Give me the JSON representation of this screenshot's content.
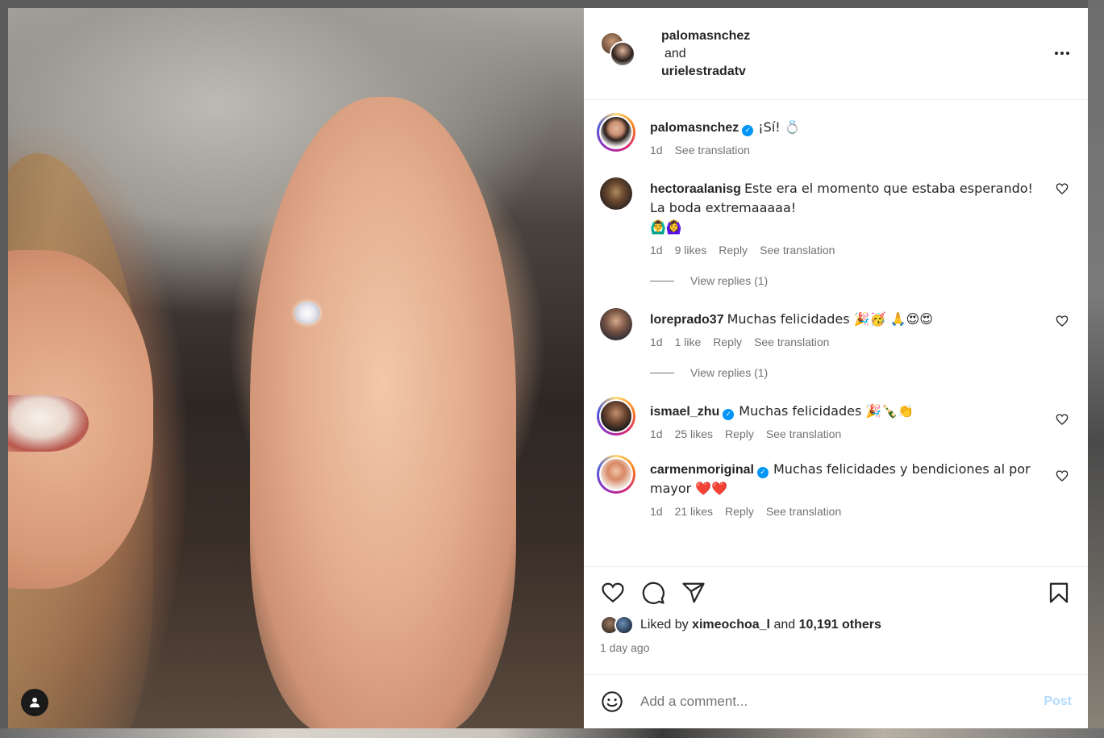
{
  "header": {
    "user1": "palomasnchez",
    "conjunction": "and",
    "user2": "urielestradatv"
  },
  "caption": {
    "user": "palomasnchez",
    "text": "¡Sí! 💍",
    "time": "1d",
    "see_translation": "See translation"
  },
  "comments": [
    {
      "user": "hectoraalanisg",
      "text": "Este era el momento que estaba esperando! La boda extremaaaaa!",
      "emoji": "🙆‍♂️🙆‍♀️",
      "time": "1d",
      "likes": "9 likes",
      "reply": "Reply",
      "see_translation": "See translation",
      "view_replies": "View replies (1)"
    },
    {
      "user": "loreprado37",
      "text": "Muchas felicidades 🎉🥳 🙏😍😍",
      "time": "1d",
      "likes": "1 like",
      "reply": "Reply",
      "see_translation": "See translation",
      "view_replies": "View replies (1)"
    },
    {
      "user": "ismael_zhu",
      "text": "Muchas felicidades 🎉🍾👏",
      "time": "1d",
      "likes": "25 likes",
      "reply": "Reply",
      "see_translation": "See translation"
    },
    {
      "user": "carmenmoriginal",
      "text": "Muchas felicidades y bendiciones al por mayor ❤️❤️",
      "time": "1d",
      "likes": "21 likes",
      "reply": "Reply",
      "see_translation": "See translation"
    }
  ],
  "likes": {
    "prefix": "Liked by",
    "user": "ximeochoa_l",
    "middle": "and",
    "others": "10,191 others",
    "time_ago": "1 day ago"
  },
  "comment_box": {
    "placeholder": "Add a comment...",
    "post_label": "Post"
  },
  "icons": {
    "like": "heart-icon",
    "comment": "comment-icon",
    "share": "paper-plane-icon",
    "save": "bookmark-icon",
    "emoji": "smiley-icon",
    "more": "more-horizontal-icon",
    "tag": "user-tag-icon"
  },
  "colors": {
    "verified": "#0095f6",
    "post_disabled": "#b3dbff",
    "secondary_text": "#737373"
  }
}
